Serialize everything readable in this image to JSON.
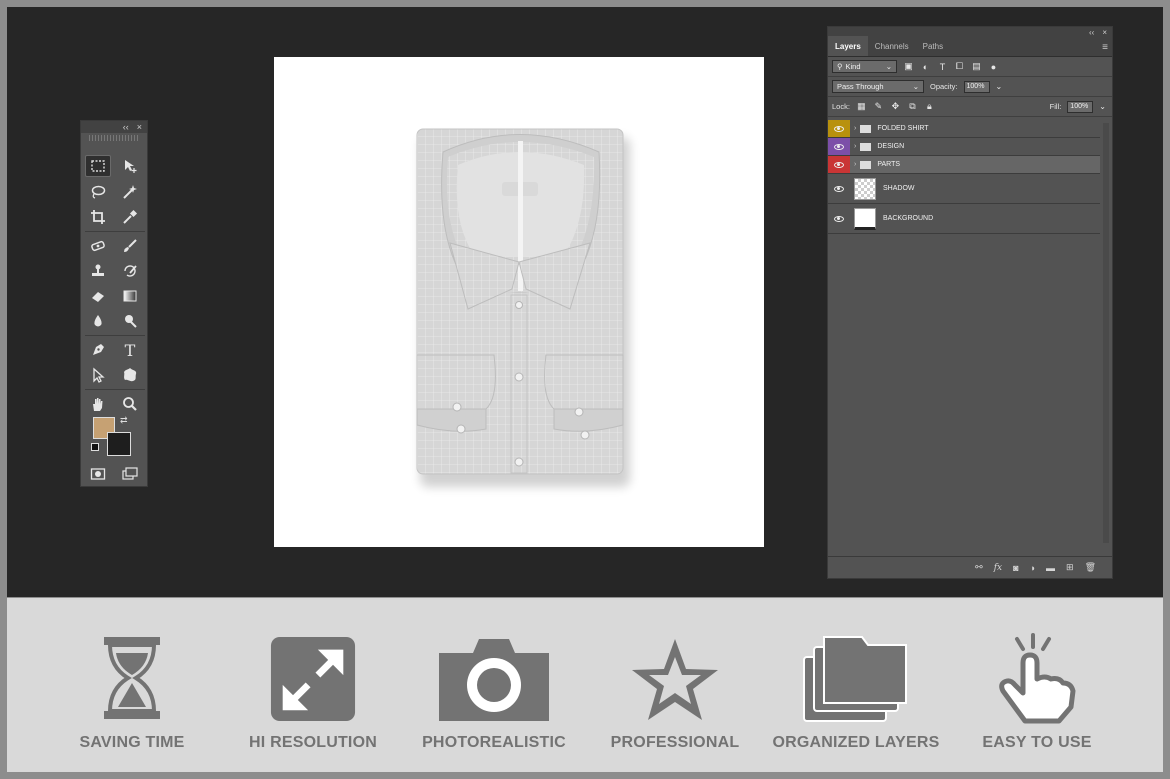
{
  "toolbox": {
    "header_collapse": "‹‹",
    "header_close": "×",
    "tools": [
      {
        "name": "rectangular-marquee-icon"
      },
      {
        "name": "move-icon"
      },
      {
        "name": "lasso-icon"
      },
      {
        "name": "magic-wand-icon"
      },
      {
        "name": "crop-icon"
      },
      {
        "name": "eyedropper-icon"
      },
      {
        "name": "spot-healing-icon"
      },
      {
        "name": "brush-icon"
      },
      {
        "name": "clone-stamp-icon"
      },
      {
        "name": "history-brush-icon"
      },
      {
        "name": "eraser-icon"
      },
      {
        "name": "gradient-icon"
      },
      {
        "name": "blur-icon"
      },
      {
        "name": "dodge-icon"
      },
      {
        "name": "pen-icon"
      },
      {
        "name": "type-icon"
      },
      {
        "name": "path-selection-icon"
      },
      {
        "name": "custom-shape-icon"
      },
      {
        "name": "hand-icon"
      },
      {
        "name": "zoom-icon"
      }
    ],
    "foreground_color": "#c6a173",
    "background_color": "#1e1e1e"
  },
  "layers_panel": {
    "tabs": [
      "Layers",
      "Channels",
      "Paths"
    ],
    "active_tab": "Layers",
    "filter_kind": "Kind",
    "blend_mode": "Pass Through",
    "opacity_label": "Opacity:",
    "opacity_value": "100%",
    "lock_label": "Lock:",
    "fill_label": "Fill:",
    "fill_value": "100%",
    "layers": [
      {
        "name": "FOLDED SHIRT",
        "type": "group",
        "color": "#b8910e"
      },
      {
        "name": "DESIGN",
        "type": "group",
        "color": "#7c4fa8"
      },
      {
        "name": "PARTS",
        "type": "group",
        "color": "#c93535"
      },
      {
        "name": "SHADOW",
        "type": "layer",
        "color": ""
      },
      {
        "name": "BACKGROUND",
        "type": "layer",
        "color": ""
      }
    ],
    "footer_fx": "fx"
  },
  "features": [
    {
      "label": "SAVING TIME",
      "icon": "hourglass-icon"
    },
    {
      "label": "HI RESOLUTION",
      "icon": "expand-arrows-icon"
    },
    {
      "label": "PHOTOREALISTIC",
      "icon": "camera-icon"
    },
    {
      "label": "PROFESSIONAL",
      "icon": "star-icon"
    },
    {
      "label": "ORGANIZED LAYERS",
      "icon": "layered-folders-icon"
    },
    {
      "label": "EASY TO USE",
      "icon": "tap-hand-icon"
    }
  ],
  "colors": {
    "workspace": "#262626",
    "panel": "#535353",
    "feature_icon": "#737373",
    "bottom_band": "#d9d9d9"
  }
}
